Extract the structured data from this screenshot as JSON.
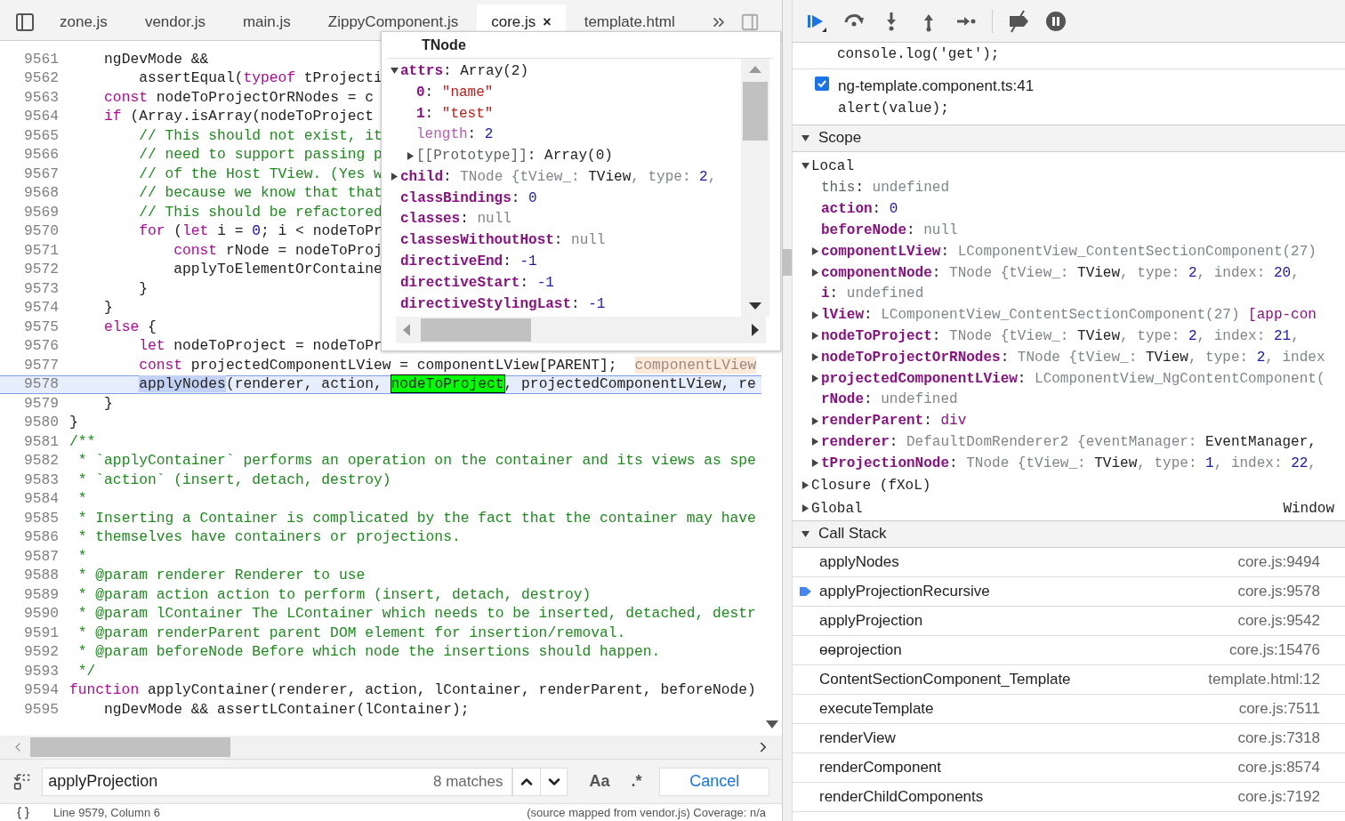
{
  "editor_tabs": [
    {
      "label": "zone.js",
      "selected": false
    },
    {
      "label": "vendor.js",
      "selected": false
    },
    {
      "label": "main.js",
      "selected": false
    },
    {
      "label": "ZippyComponent.js",
      "selected": false
    },
    {
      "label": "core.js",
      "selected": true,
      "close": "×"
    },
    {
      "label": "template.html",
      "selected": false
    }
  ],
  "code_lines": [
    {
      "number": "9561",
      "current": false,
      "segments": [
        {
          "text": "    ngDevMode &&",
          "kind": "plain"
        }
      ]
    },
    {
      "number": "9562",
      "current": false,
      "segments": [
        {
          "text": "        assertEqual(",
          "kind": "plain"
        },
        {
          "text": "typeof",
          "kind": "keyword"
        },
        {
          "text": " tProjecti",
          "kind": "plain"
        }
      ]
    },
    {
      "number": "9563",
      "current": false,
      "segments": [
        {
          "text": "    const",
          "kind": "keyword"
        },
        {
          "text": " nodeToProjectOrRNodes = c",
          "kind": "plain"
        }
      ]
    },
    {
      "number": "9564",
      "current": false,
      "segments": [
        {
          "text": "    if",
          "kind": "keyword"
        },
        {
          "text": " (Array.isArray(nodeToProject",
          "kind": "plain"
        }
      ]
    },
    {
      "number": "9565",
      "current": false,
      "segments": [
        {
          "text": "        // This should not exist, it",
          "kind": "comment"
        }
      ]
    },
    {
      "number": "9566",
      "current": false,
      "segments": [
        {
          "text": "        // need to support passing p",
          "kind": "comment"
        }
      ]
    },
    {
      "number": "9567",
      "current": false,
      "segments": [
        {
          "text": "        // of the Host TView. (Yes w",
          "kind": "comment"
        }
      ]
    },
    {
      "number": "9568",
      "current": false,
      "segments": [
        {
          "text": "        // because we know that that",
          "kind": "comment"
        }
      ]
    },
    {
      "number": "9569",
      "current": false,
      "segments": [
        {
          "text": "        // This should be refactored",
          "kind": "comment"
        }
      ]
    },
    {
      "number": "9570",
      "current": false,
      "segments": [
        {
          "text": "        for",
          "kind": "keyword"
        },
        {
          "text": " (",
          "kind": "plain"
        },
        {
          "text": "let",
          "kind": "keyword"
        },
        {
          "text": " i = ",
          "kind": "plain"
        },
        {
          "text": "0",
          "kind": "number"
        },
        {
          "text": "; i < nodeToPr",
          "kind": "plain"
        }
      ]
    },
    {
      "number": "9571",
      "current": false,
      "segments": [
        {
          "text": "            const",
          "kind": "keyword"
        },
        {
          "text": " rNode = nodeToProj",
          "kind": "plain"
        }
      ]
    },
    {
      "number": "9572",
      "current": false,
      "segments": [
        {
          "text": "            applyToElementOrContaine",
          "kind": "plain"
        }
      ]
    },
    {
      "number": "9573",
      "current": false,
      "segments": [
        {
          "text": "        }",
          "kind": "plain"
        }
      ]
    },
    {
      "number": "9574",
      "current": false,
      "segments": [
        {
          "text": "    }",
          "kind": "plain"
        }
      ]
    },
    {
      "number": "9575",
      "current": false,
      "segments": [
        {
          "text": "    else",
          "kind": "keyword"
        },
        {
          "text": " {",
          "kind": "plain"
        }
      ]
    },
    {
      "number": "9576",
      "current": false,
      "segments": [
        {
          "text": "        let",
          "kind": "keyword"
        },
        {
          "text": " nodeToProject = nodeToPr",
          "kind": "plain"
        }
      ]
    },
    {
      "number": "9577",
      "current": false,
      "segments": [
        {
          "text": "        const",
          "kind": "keyword"
        },
        {
          "text": " projectedComponentLView = componentLView[PARENT];",
          "kind": "plain"
        },
        {
          "text": "componentLView",
          "kind": "hint"
        }
      ]
    },
    {
      "number": "9578",
      "current": true,
      "segments": [
        {
          "text": "        applyNodes",
          "kind": "selection"
        },
        {
          "text": "(renderer, action, ",
          "kind": "plain"
        },
        {
          "text": "nodeToProject",
          "kind": "match"
        },
        {
          "text": ", projectedComponentLView, re",
          "kind": "plain"
        }
      ]
    },
    {
      "number": "9579",
      "current": false,
      "segments": [
        {
          "text": "    }",
          "kind": "plain"
        }
      ]
    },
    {
      "number": "9580",
      "current": false,
      "segments": [
        {
          "text": "}",
          "kind": "plain"
        }
      ]
    },
    {
      "number": "9581",
      "current": false,
      "segments": [
        {
          "text": "/**",
          "kind": "comment"
        }
      ]
    },
    {
      "number": "9582",
      "current": false,
      "segments": [
        {
          "text": " * `applyContainer` performs an operation on the container and its views as spe",
          "kind": "comment"
        }
      ]
    },
    {
      "number": "9583",
      "current": false,
      "segments": [
        {
          "text": " * `action` (insert, detach, destroy)",
          "kind": "comment"
        }
      ]
    },
    {
      "number": "9584",
      "current": false,
      "segments": [
        {
          "text": " *",
          "kind": "comment"
        }
      ]
    },
    {
      "number": "9585",
      "current": false,
      "segments": [
        {
          "text": " * Inserting a Container is complicated by the fact that the container may have",
          "kind": "comment"
        }
      ]
    },
    {
      "number": "9586",
      "current": false,
      "segments": [
        {
          "text": " * themselves have containers or projections.",
          "kind": "comment"
        }
      ]
    },
    {
      "number": "9587",
      "current": false,
      "segments": [
        {
          "text": " *",
          "kind": "comment"
        }
      ]
    },
    {
      "number": "9588",
      "current": false,
      "segments": [
        {
          "text": " * @param renderer Renderer to use",
          "kind": "comment"
        }
      ]
    },
    {
      "number": "9589",
      "current": false,
      "segments": [
        {
          "text": " * @param action action to perform (insert, detach, destroy)",
          "kind": "comment"
        }
      ]
    },
    {
      "number": "9590",
      "current": false,
      "segments": [
        {
          "text": " * @param lContainer The LContainer which needs to be inserted, detached, destr",
          "kind": "comment"
        }
      ]
    },
    {
      "number": "9591",
      "current": false,
      "segments": [
        {
          "text": " * @param renderParent parent DOM element for insertion/removal.",
          "kind": "comment"
        }
      ]
    },
    {
      "number": "9592",
      "current": false,
      "segments": [
        {
          "text": " * @param beforeNode Before which node the insertions should happen.",
          "kind": "comment"
        }
      ]
    },
    {
      "number": "9593",
      "current": false,
      "segments": [
        {
          "text": " */",
          "kind": "comment"
        }
      ]
    },
    {
      "number": "9594",
      "current": false,
      "segments": [
        {
          "text": "function",
          "kind": "keyword"
        },
        {
          "text": " applyContainer(renderer, action, lContainer, renderParent, beforeNode)",
          "kind": "plain"
        }
      ]
    },
    {
      "number": "9595",
      "current": false,
      "segments": [
        {
          "text": "    ngDevMode && assertLContainer(lContainer);",
          "kind": "plain"
        }
      ]
    }
  ],
  "popover": {
    "title": "TNode",
    "properties": [
      {
        "name": "attrs",
        "kind": "key",
        "expandable": true,
        "expanded": true,
        "value": [
          {
            "text": ": ",
            "kind": "plain"
          },
          {
            "text": "Array(2)",
            "kind": "plain"
          }
        ],
        "children": [
          {
            "name": "0",
            "kind": "key",
            "expandable": false,
            "value": [
              {
                "text": ": ",
                "kind": "plain"
              },
              {
                "text": "\"name\"",
                "kind": "string"
              }
            ]
          },
          {
            "name": "1",
            "kind": "key",
            "expandable": false,
            "value": [
              {
                "text": ": ",
                "kind": "plain"
              },
              {
                "text": "\"test\"",
                "kind": "string"
              }
            ]
          },
          {
            "name": "length",
            "kind": "faint",
            "expandable": false,
            "value": [
              {
                "text": ": ",
                "kind": "plain"
              },
              {
                "text": "2",
                "kind": "number"
              }
            ]
          },
          {
            "name": "[[Prototype]]",
            "kind": "dim",
            "expandable": true,
            "expanded": false,
            "value": [
              {
                "text": ": ",
                "kind": "plain"
              },
              {
                "text": "Array(0)",
                "kind": "plain"
              }
            ]
          }
        ]
      },
      {
        "name": "child",
        "kind": "key",
        "expandable": true,
        "expanded": false,
        "value": [
          {
            "text": ": ",
            "kind": "plain"
          },
          {
            "text": "TNode {tView_: ",
            "kind": "dim"
          },
          {
            "text": "TView",
            "kind": "plain"
          },
          {
            "text": ", type: ",
            "kind": "dim"
          },
          {
            "text": "2",
            "kind": "number"
          },
          {
            "text": ",",
            "kind": "dim"
          }
        ]
      },
      {
        "name": "classBindings",
        "kind": "key",
        "expandable": false,
        "value": [
          {
            "text": ": ",
            "kind": "plain"
          },
          {
            "text": "0",
            "kind": "number"
          }
        ]
      },
      {
        "name": "classes",
        "kind": "key",
        "expandable": false,
        "value": [
          {
            "text": ": ",
            "kind": "plain"
          },
          {
            "text": "null",
            "kind": "dim"
          }
        ]
      },
      {
        "name": "classesWithoutHost",
        "kind": "key",
        "expandable": false,
        "value": [
          {
            "text": ": ",
            "kind": "plain"
          },
          {
            "text": "null",
            "kind": "dim"
          }
        ]
      },
      {
        "name": "directiveEnd",
        "kind": "key",
        "expandable": false,
        "value": [
          {
            "text": ": ",
            "kind": "plain"
          },
          {
            "text": "-1",
            "kind": "number"
          }
        ]
      },
      {
        "name": "directiveStart",
        "kind": "key",
        "expandable": false,
        "value": [
          {
            "text": ": ",
            "kind": "plain"
          },
          {
            "text": "-1",
            "kind": "number"
          }
        ]
      },
      {
        "name": "directiveStylingLast",
        "kind": "key",
        "expandable": false,
        "value": [
          {
            "text": ": ",
            "kind": "plain"
          },
          {
            "text": "-1",
            "kind": "number"
          }
        ]
      }
    ]
  },
  "search": {
    "value": "applyProjection",
    "matches": "8 matches",
    "case_button": "Aa",
    "regex_button": ".*",
    "cancel": "Cancel"
  },
  "status_bar": {
    "position": "Line 9579, Column 6",
    "source": "(source mapped from vendor.js) Coverage: n/a"
  },
  "breakpoints": {
    "partial_code": "console.log('get');",
    "items": [
      {
        "checked": true,
        "location": "ng-template.component.ts:41",
        "code": "alert(value);"
      }
    ]
  },
  "scope": {
    "title": "Scope",
    "expanded": true,
    "groups": [
      {
        "label": "Local",
        "expandable": true,
        "expanded": true,
        "properties": [
          {
            "name": "this",
            "kind": "dim",
            "expandable": false,
            "value": [
              {
                "text": ": ",
                "kind": "plain"
              },
              {
                "text": "undefined",
                "kind": "dim"
              }
            ]
          },
          {
            "name": "action",
            "kind": "key",
            "expandable": false,
            "value": [
              {
                "text": ": ",
                "kind": "plain"
              },
              {
                "text": "0",
                "kind": "number"
              }
            ]
          },
          {
            "name": "beforeNode",
            "kind": "key",
            "expandable": false,
            "value": [
              {
                "text": ": ",
                "kind": "plain"
              },
              {
                "text": "null",
                "kind": "dim"
              }
            ]
          },
          {
            "name": "componentLView",
            "kind": "key",
            "expandable": true,
            "expanded": false,
            "value": [
              {
                "text": ": ",
                "kind": "plain"
              },
              {
                "text": "LComponentView_ContentSectionComponent(27)",
                "kind": "dim"
              }
            ]
          },
          {
            "name": "componentNode",
            "kind": "key",
            "expandable": true,
            "expanded": false,
            "value": [
              {
                "text": ": ",
                "kind": "plain"
              },
              {
                "text": "TNode {tView_: ",
                "kind": "dim"
              },
              {
                "text": "TView",
                "kind": "plain"
              },
              {
                "text": ", type: ",
                "kind": "dim"
              },
              {
                "text": "2",
                "kind": "number"
              },
              {
                "text": ", index: ",
                "kind": "dim"
              },
              {
                "text": "20",
                "kind": "number"
              },
              {
                "text": ",",
                "kind": "dim"
              }
            ]
          },
          {
            "name": "i",
            "kind": "key",
            "expandable": false,
            "value": [
              {
                "text": ": ",
                "kind": "plain"
              },
              {
                "text": "undefined",
                "kind": "dim"
              }
            ]
          },
          {
            "name": "lView",
            "kind": "key",
            "expandable": true,
            "expanded": false,
            "value": [
              {
                "text": ": ",
                "kind": "plain"
              },
              {
                "text": "LComponentView_ContentSectionComponent(27) ",
                "kind": "dim"
              },
              {
                "text": "[app-con",
                "kind": "tag"
              }
            ]
          },
          {
            "name": "nodeToProject",
            "kind": "key",
            "expandable": true,
            "expanded": false,
            "value": [
              {
                "text": ": ",
                "kind": "plain"
              },
              {
                "text": "TNode {tView_: ",
                "kind": "dim"
              },
              {
                "text": "TView",
                "kind": "plain"
              },
              {
                "text": ", type: ",
                "kind": "dim"
              },
              {
                "text": "2",
                "kind": "number"
              },
              {
                "text": ", index: ",
                "kind": "dim"
              },
              {
                "text": "21",
                "kind": "number"
              },
              {
                "text": ",",
                "kind": "dim"
              }
            ]
          },
          {
            "name": "nodeToProjectOrRNodes",
            "kind": "key",
            "expandable": true,
            "expanded": false,
            "value": [
              {
                "text": ": ",
                "kind": "plain"
              },
              {
                "text": "TNode {tView_: ",
                "kind": "dim"
              },
              {
                "text": "TView",
                "kind": "plain"
              },
              {
                "text": ", type: ",
                "kind": "dim"
              },
              {
                "text": "2",
                "kind": "number"
              },
              {
                "text": ", index",
                "kind": "dim"
              }
            ]
          },
          {
            "name": "projectedComponentLView",
            "kind": "key",
            "expandable": true,
            "expanded": false,
            "value": [
              {
                "text": ": ",
                "kind": "plain"
              },
              {
                "text": "LComponentView_NgContentComponent(",
                "kind": "dim"
              }
            ]
          },
          {
            "name": "rNode",
            "kind": "key",
            "expandable": false,
            "value": [
              {
                "text": ": ",
                "kind": "plain"
              },
              {
                "text": "undefined",
                "kind": "dim"
              }
            ]
          },
          {
            "name": "renderParent",
            "kind": "key",
            "expandable": true,
            "expanded": false,
            "value": [
              {
                "text": ": ",
                "kind": "plain"
              },
              {
                "text": "div",
                "kind": "tag"
              }
            ]
          },
          {
            "name": "renderer",
            "kind": "key",
            "expandable": true,
            "expanded": false,
            "value": [
              {
                "text": ": ",
                "kind": "plain"
              },
              {
                "text": "DefaultDomRenderer2 {eventManager: ",
                "kind": "dim"
              },
              {
                "text": "EventManager,",
                "kind": "plain"
              }
            ]
          },
          {
            "name": "tProjectionNode",
            "kind": "key",
            "expandable": true,
            "expanded": false,
            "value": [
              {
                "text": ": ",
                "kind": "plain"
              },
              {
                "text": "TNode {tView_: ",
                "kind": "dim"
              },
              {
                "text": "TView",
                "kind": "plain"
              },
              {
                "text": ", type: ",
                "kind": "dim"
              },
              {
                "text": "1",
                "kind": "number"
              },
              {
                "text": ", index: ",
                "kind": "dim"
              },
              {
                "text": "22",
                "kind": "number"
              },
              {
                "text": ",",
                "kind": "dim"
              }
            ]
          }
        ]
      },
      {
        "label": "Closure (fXoL)",
        "expandable": true,
        "expanded": false
      },
      {
        "label": "Global",
        "expandable": true,
        "expanded": false,
        "value": "Window"
      }
    ]
  },
  "call_stack": {
    "title": "Call Stack",
    "expanded": true,
    "frames": [
      {
        "name": "applyNodes",
        "location": "core.js:9494",
        "selected": false
      },
      {
        "name": "applyProjectionRecursive",
        "location": "core.js:9578",
        "selected": true
      },
      {
        "name": "applyProjection",
        "location": "core.js:9542",
        "selected": false
      },
      {
        "name": "ɵɵprojection",
        "location": "core.js:15476",
        "selected": false
      },
      {
        "name": "ContentSectionComponent_Template",
        "location": "template.html:12",
        "selected": false
      },
      {
        "name": "executeTemplate",
        "location": "core.js:7511",
        "selected": false
      },
      {
        "name": "renderView",
        "location": "core.js:7318",
        "selected": false
      },
      {
        "name": "renderComponent",
        "location": "core.js:8574",
        "selected": false
      },
      {
        "name": "renderChildComponents",
        "location": "core.js:7192",
        "selected": false
      }
    ]
  }
}
